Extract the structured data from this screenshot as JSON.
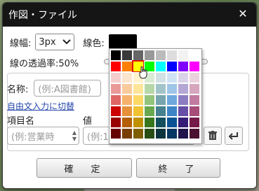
{
  "dialog": {
    "title": "作図・ファイル",
    "close_glyph": "✕"
  },
  "line": {
    "width_label": "線幅:",
    "width_value": "3px",
    "color_label": "線色:",
    "color_value": "#000000",
    "opacity_label": "線の透過率:50%"
  },
  "form": {
    "name_label": "名称:",
    "name_placeholder": "(例:A図書館)",
    "free_text_link": "自由文入力に切替",
    "key_header": "項目名",
    "value_header": "値",
    "key_placeholder": "(例:営業時",
    "value_placeholder": "(例:1"
  },
  "buttons": {
    "confirm": "確　定",
    "finish": "終　了"
  },
  "palette": {
    "colors": [
      "#000000",
      "#3a3a3a",
      "#666666",
      "#999999",
      "#bbbbbb",
      "#dddddd",
      "#f2f2f2",
      "#ffffff",
      "#ff0000",
      "#ff8000",
      "#ffff00",
      "#00ff00",
      "#00ffff",
      "#0000ff",
      "#8000ff",
      "#ff00ff",
      "#f4cccc",
      "#fce5cd",
      "#fff2cc",
      "#d9ead3",
      "#d0e0e3",
      "#cfe2f3",
      "#d9d2e9",
      "#ead1dc",
      "#ea9999",
      "#f9cb9c",
      "#ffe599",
      "#b6d7a8",
      "#a2c4c9",
      "#9fc5e8",
      "#b4a7d6",
      "#d5a6bd",
      "#e06666",
      "#f6b26b",
      "#ffd966",
      "#93c47d",
      "#76a5af",
      "#6fa8dc",
      "#8e7cc3",
      "#c27ba0",
      "#cc0000",
      "#e69138",
      "#f1c232",
      "#6aa84f",
      "#45818e",
      "#3d85c6",
      "#674ea7",
      "#a64d79",
      "#990000",
      "#b45f06",
      "#bf9000",
      "#38761d",
      "#134f5c",
      "#0b5394",
      "#351c75",
      "#741b47",
      "#660000",
      "#783f04",
      "#7f6000",
      "#274e13",
      "#0c343d",
      "#073763",
      "#20124d",
      "#4c1130"
    ],
    "selected_index": 10
  }
}
